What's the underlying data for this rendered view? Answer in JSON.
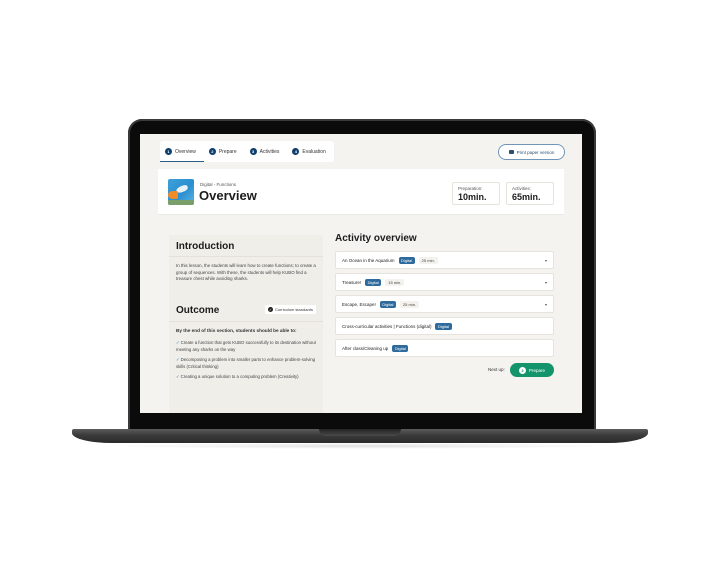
{
  "tabs": [
    {
      "num": "1",
      "label": "Overview",
      "active": true
    },
    {
      "num": "2",
      "label": "Prepare",
      "active": false
    },
    {
      "num": "3",
      "label": "Activities",
      "active": false
    },
    {
      "num": "4",
      "label": "Evaluation",
      "active": false
    }
  ],
  "print_button": {
    "label": "Print paper version",
    "icon": "printer-icon"
  },
  "header": {
    "breadcrumb": "Digital - Functions",
    "title": "Overview",
    "stats": [
      {
        "label": "Preparation:",
        "value": "10min."
      },
      {
        "label": "Activities:",
        "value": "65min."
      }
    ]
  },
  "introduction": {
    "title": "Introduction",
    "text": "In this lesson, the students will learn how to create functions; to create a group of sequences. With these, the students will help KUBO find a treasure chest while avoiding sharks."
  },
  "outcome": {
    "title": "Outcome",
    "badge": "Curriculum standards",
    "lead": "By the end of this section, students should be able to:",
    "items": [
      "Create a function that gets KUBO successfully to its destination without meeting any sharks on the way",
      "Decomposing a problem into smaller parts to enhance problem-solving skills (Critical thinking)",
      "Creating a unique solution to a computing problem (Creativity)"
    ]
  },
  "activity_overview": {
    "title": "Activity overview",
    "activities": [
      {
        "name": "An Ocean in the Aquarium",
        "badge": "Digital",
        "time": "25 min.",
        "expandable": true
      },
      {
        "name": "Treasure!",
        "badge": "Digital",
        "time": "15 min.",
        "expandable": true
      },
      {
        "name": "Escape, Escape!",
        "badge": "Digital",
        "time": "25 min.",
        "expandable": true
      },
      {
        "name": "Cross-curricular activities | Functions (digital)",
        "badge": "Digital",
        "time": null,
        "expandable": false
      },
      {
        "name": "After class/Cleaning up",
        "badge": "Digital",
        "time": null,
        "expandable": false
      }
    ]
  },
  "next_up": {
    "label": "Next up:",
    "button_num": "2",
    "button_label": "Prepare"
  },
  "colors": {
    "accent_blue": "#0d3e6e",
    "digital_badge": "#2e6b9c",
    "next_green": "#13946a",
    "background": "#f4f3ef"
  }
}
